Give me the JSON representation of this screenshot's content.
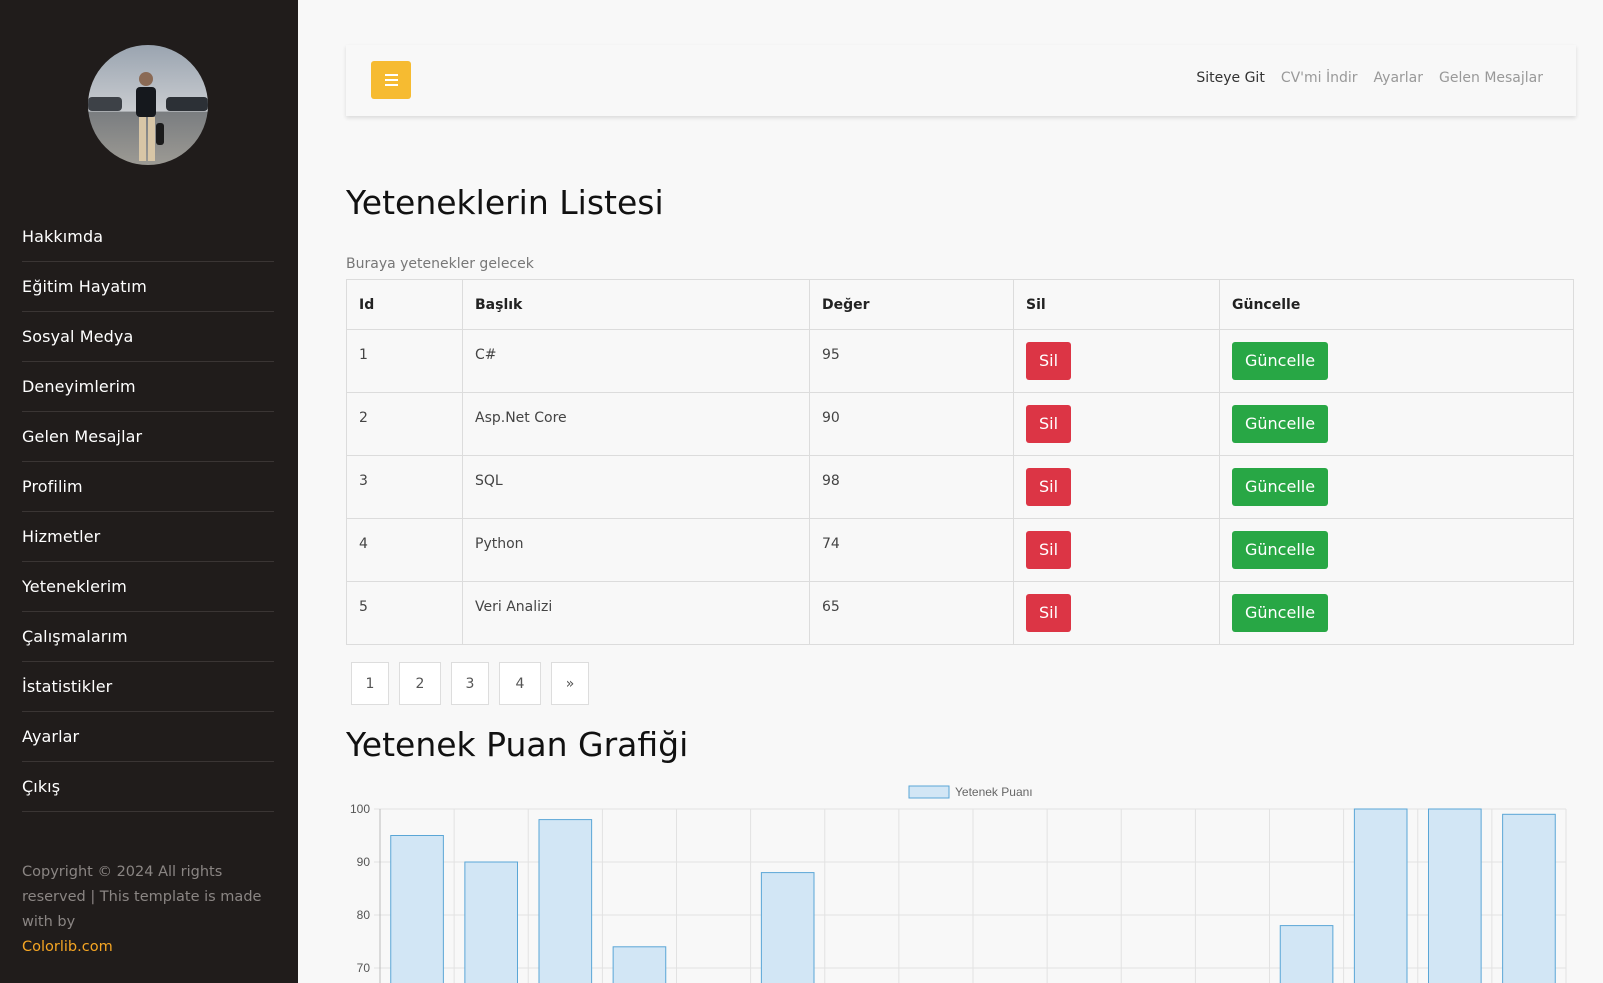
{
  "sidebar": {
    "nav": [
      "Hakkımda",
      "Eğitim Hayatım",
      "Sosyal Medya",
      "Deneyimlerim",
      "Gelen Mesajlar",
      "Profilim",
      "Hizmetler",
      "Yeteneklerim",
      "Çalışmalarım",
      "İstatistikler",
      "Ayarlar",
      "Çıkış"
    ],
    "copyright": "Copyright © 2024 All rights reserved | This template is made with by",
    "credit": "Colorlib.com"
  },
  "header": {
    "links": [
      "Siteye Git",
      "CV'mi İndir",
      "Ayarlar",
      "Gelen Mesajlar"
    ]
  },
  "main": {
    "title": "Yeteneklerin Listesi",
    "caption": "Buraya yetenekler gelecek",
    "columns": [
      "Id",
      "Başlık",
      "Değer",
      "Sil",
      "Güncelle"
    ],
    "rows": [
      {
        "id": "1",
        "title": "C#",
        "value": "95"
      },
      {
        "id": "2",
        "title": "Asp.Net Core",
        "value": "90"
      },
      {
        "id": "3",
        "title": "SQL",
        "value": "98"
      },
      {
        "id": "4",
        "title": "Python",
        "value": "74"
      },
      {
        "id": "5",
        "title": "Veri Analizi",
        "value": "65"
      }
    ],
    "delete_label": "Sil",
    "update_label": "Güncelle",
    "pagination": [
      "1",
      "2",
      "3",
      "4",
      "»"
    ],
    "chart_title": "Yetenek Puan Grafiği"
  },
  "colors": {
    "sidebar_bg": "#201c1b",
    "accent": "#f6bb31",
    "delete": "#dc3545",
    "update": "#28a745",
    "bar_fill": "#d2e6f5",
    "bar_stroke": "#5aa6d6"
  },
  "chart_data": {
    "type": "bar",
    "legend": "Yetenek Puanı",
    "legend_position": "top",
    "yticks": [
      100,
      90,
      80,
      70
    ],
    "ylim": [
      70,
      100
    ],
    "grid": true,
    "values": [
      95,
      90,
      98,
      74,
      null,
      88,
      null,
      null,
      null,
      null,
      null,
      null,
      78,
      100,
      100,
      99
    ]
  }
}
